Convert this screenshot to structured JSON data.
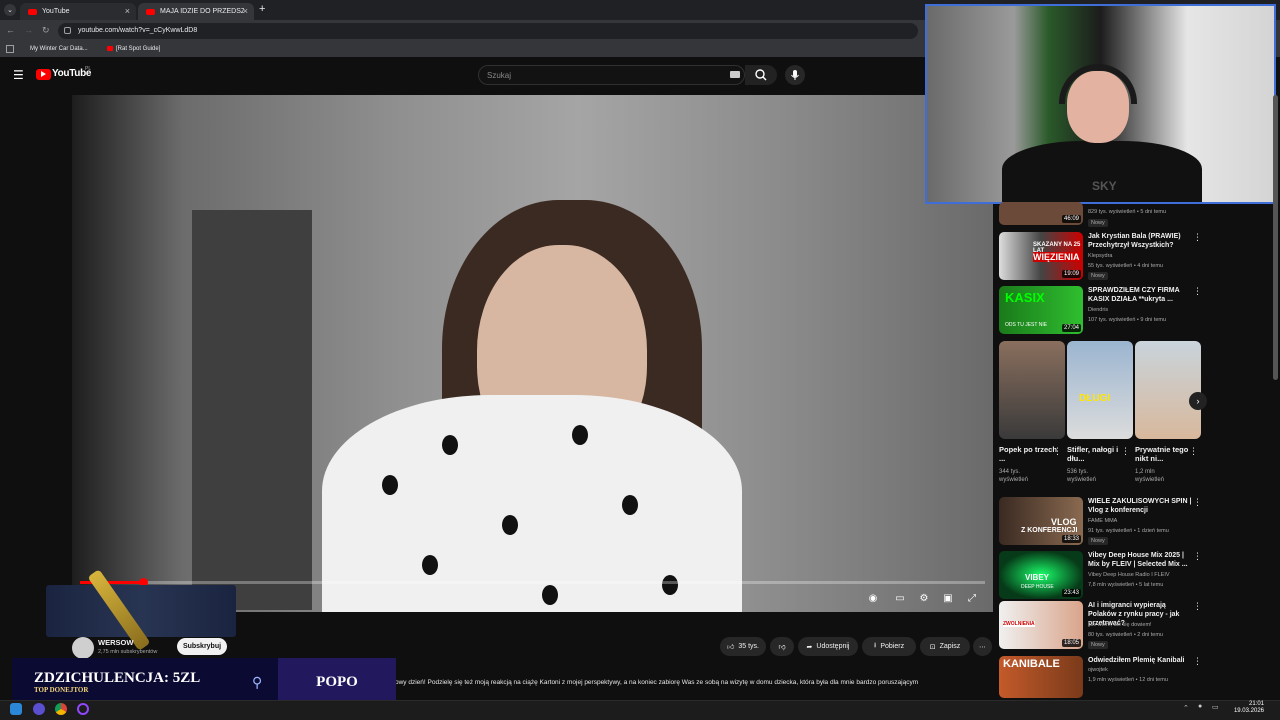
{
  "browser": {
    "tabs": [
      {
        "label": "YouTube",
        "active": false
      },
      {
        "label": "MAJA IDZIE DO PRZEDSZKOLA",
        "active": true
      }
    ],
    "url": "youtube.com/watch?v=_cCyKwwLdD8",
    "bookmarks": [
      "My Winter Car Data...",
      "[Rat Spot Guide]"
    ]
  },
  "youtube": {
    "logo": "YouTube",
    "logo_sup": "PL",
    "search_placeholder": "Szukaj"
  },
  "player": {
    "progress": 0.07
  },
  "channel": {
    "name": "WERSOW",
    "subscribers": "2,75 mln subskrybentów",
    "subscribe_label": "Subskrybuj"
  },
  "actions": {
    "likes": "35 tys.",
    "share": "Udostępnij",
    "download": "Pobierz",
    "save": "Zapisz"
  },
  "description": "owy dzień! Podzielę się też moją reakcją na ciążę Kartoni z mojej perspektywy, a na koniec zabiorę Was ze sobą na wizytę w domu dziecka, która była dla mnie bardzo poruszającym",
  "donation": {
    "text": "ZDZICHULENCJA: 5ZL",
    "sub": "TOP DONEJTOR",
    "right": "POPO"
  },
  "recommended": [
    {
      "title": "",
      "meta1": "",
      "meta2": "829 tys. wyświetleń • 5 dni temu",
      "badge": "Nowy",
      "duration": "46:09"
    },
    {
      "title": "Jak Krystian Bala (PRAWIE) Przechytrzył Wszystkich?",
      "meta1": "Klepsydra",
      "meta2": "55 tys. wyświetleń • 4 dni temu",
      "badge": "Nowy",
      "duration": "19:09"
    },
    {
      "title": "SPRAWDZIŁEM CZY FIRMA KASIX DZIAŁA **ukryta ...",
      "meta1": "Diendris",
      "meta2": "107 tys. wyświetleń • 9 dni temu",
      "badge": "",
      "duration": "27:04"
    }
  ],
  "shorts": [
    {
      "title": "Popek po trzech ...",
      "views": "344 tys. wyświetleń"
    },
    {
      "title": "Stifler, nałogi i dłu...",
      "views": "536 tys. wyświetleń"
    },
    {
      "title": "Prywatnie tego nikt ni...",
      "views": "1,2 mln wyświetleń"
    }
  ],
  "recommended2": [
    {
      "title": "WIELE ZAKULISOWYCH SPIN | Vlog z konferencji",
      "meta1": "FAME MMA",
      "meta2": "91 tys. wyświetleń • 1 dzień temu",
      "badge": "Nowy",
      "duration": "18:33"
    },
    {
      "title": "Vibey Deep House Mix 2025 | Mix by FLEIV | Selected Mix ...",
      "meta1": "Vibey Deep House Radio I FLEIV",
      "meta2": "7,8 mln wyświetleń • 5 lat temu",
      "badge": "",
      "duration": "23:43"
    },
    {
      "title": "AI i imigranci wypierają Polaków z rynku pracy - jak przetrwać?",
      "meta1": "Nie wiem, ale się dowiem!",
      "meta2": "80 tys. wyświetleń • 2 dni temu",
      "badge": "Nowy",
      "duration": "18:05"
    },
    {
      "title": "Odwiedziłem Plemię Kanibali",
      "meta1": "ojwojtek",
      "meta2": "1,9 mln wyświetleń • 12 dni temu",
      "badge": "",
      "duration": ""
    }
  ],
  "thumb_text": {
    "r1": "SKAZANY NA 25 LAT",
    "r1b": "WIĘZIENIA",
    "r2": "KASIX",
    "r2b": "ODS TU JEST NIE",
    "s2": "DŁUGI",
    "v1": "VLOG",
    "v1b": "Z KONFERENCJI",
    "v2": "VIBEY",
    "v2b": "DEEP HOUSE",
    "v3": "ZWOLNIENIA",
    "v4": "KANIBALE"
  },
  "webcam": {
    "shirt": "SKY"
  },
  "taskbar": {
    "time": "21:01",
    "date": "19.03.2026"
  },
  "colors": {
    "accent": "#ff0000",
    "webcam_border": "#3f6ed8",
    "donation_bg": "#0b0a33"
  }
}
